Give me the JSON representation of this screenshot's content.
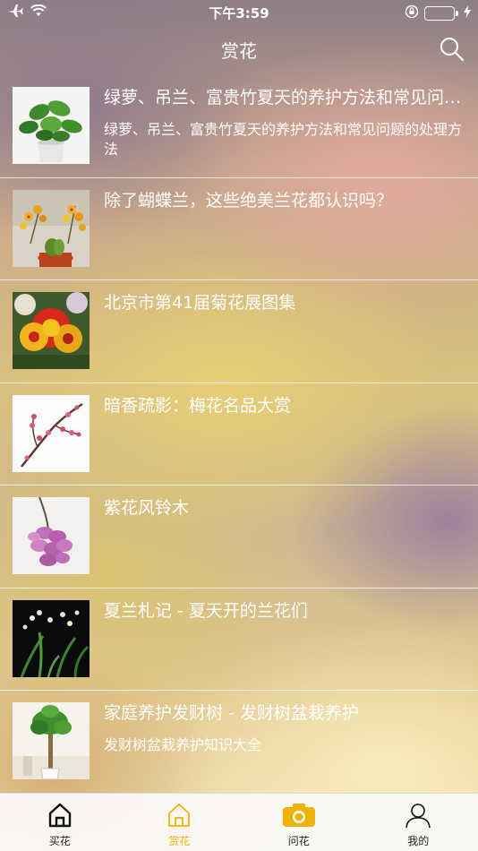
{
  "status_bar": {
    "time": "下午3:59",
    "battery_color": "#4cd964"
  },
  "nav": {
    "title": "赏花",
    "search_icon": "search-icon"
  },
  "articles": [
    {
      "title": "绿萝、吊兰、富贵竹夏天的养护方法和常见问题的处理方法",
      "subtitle": "绿萝、吊兰、富贵竹夏天的养护方法和常见问题的处理方法",
      "thumb": "pothos"
    },
    {
      "title": "除了蝴蝶兰，这些绝美兰花都认识吗？",
      "subtitle": "",
      "thumb": "orchid-yellow"
    },
    {
      "title": "北京市第41届菊花展图集",
      "subtitle": "",
      "thumb": "chrysanthemum"
    },
    {
      "title": "暗香疏影：梅花名品大赏",
      "subtitle": "",
      "thumb": "plum-blossom"
    },
    {
      "title": "紫花风铃木",
      "subtitle": "",
      "thumb": "purple-bells"
    },
    {
      "title": "夏兰札记 - 夏天开的兰花们",
      "subtitle": "",
      "thumb": "summer-orchid"
    },
    {
      "title": "家庭养护发财树 - 发财树盆栽养护",
      "subtitle": "发财树盆栽养护知识大全",
      "thumb": "money-tree"
    }
  ],
  "tabs": [
    {
      "label": "买花",
      "icon": "home-icon",
      "active": false
    },
    {
      "label": "赏花",
      "icon": "home-outline-icon",
      "active": true
    },
    {
      "label": "问花",
      "icon": "camera-icon",
      "active": false
    },
    {
      "label": "我的",
      "icon": "user-icon",
      "active": false
    }
  ],
  "colors": {
    "accent": "#f0b400"
  }
}
